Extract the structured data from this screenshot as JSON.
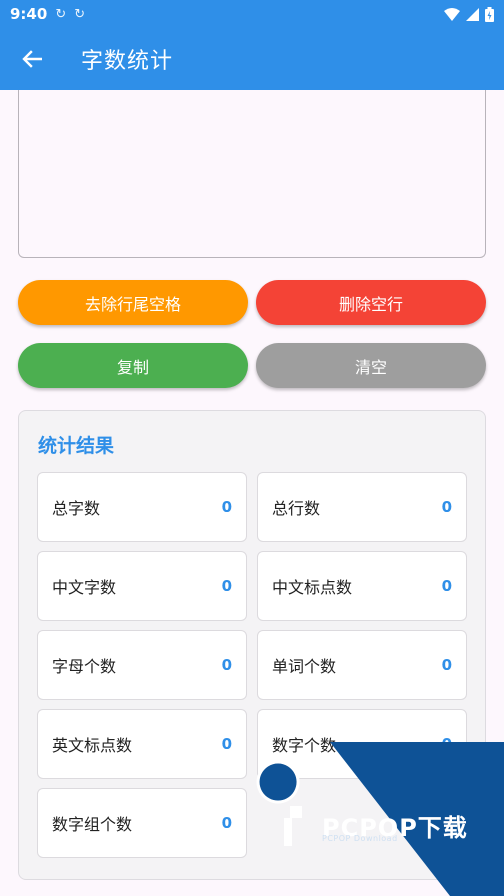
{
  "status": {
    "time": "9:40"
  },
  "appbar": {
    "title": "字数统计"
  },
  "colors": {
    "primary": "#2f8fe8",
    "orange": "#ff9800",
    "red": "#f44336",
    "green": "#4caf50",
    "gray": "#9e9e9e"
  },
  "buttons": {
    "trim_trailing": "去除行尾空格",
    "delete_empty_lines": "删除空行",
    "copy": "复制",
    "clear": "清空"
  },
  "results": {
    "title": "统计结果",
    "items": [
      {
        "label": "总字数",
        "value": "0"
      },
      {
        "label": "总行数",
        "value": "0"
      },
      {
        "label": "中文字数",
        "value": "0"
      },
      {
        "label": "中文标点数",
        "value": "0"
      },
      {
        "label": "字母个数",
        "value": "0"
      },
      {
        "label": "单词个数",
        "value": "0"
      },
      {
        "label": "英文标点数",
        "value": "0"
      },
      {
        "label": "数字个数",
        "value": "0"
      },
      {
        "label": "数字组个数",
        "value": "0"
      }
    ]
  },
  "watermark": {
    "brand": "PCPOP下载",
    "sub": "PCPOP Download"
  }
}
